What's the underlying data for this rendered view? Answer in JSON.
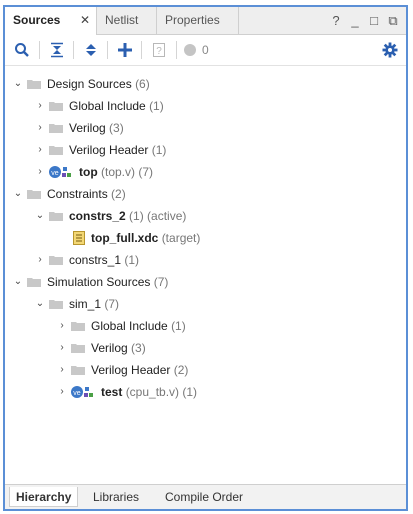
{
  "tabs": [
    {
      "label": "Sources"
    },
    {
      "label": "Netlist"
    },
    {
      "label": "Properties"
    }
  ],
  "tab_close_glyph": "✕",
  "window_controls": {
    "help": "?",
    "minimize": "_",
    "maximize": "□",
    "float": "⧉"
  },
  "toolbar": {
    "ip_count": "0"
  },
  "tree": {
    "design_sources": {
      "label": "Design Sources",
      "count": "(6)"
    },
    "ds_global_include": {
      "label": "Global Include",
      "count": "(1)"
    },
    "ds_verilog": {
      "label": "Verilog",
      "count": "(3)"
    },
    "ds_verilog_header": {
      "label": "Verilog Header",
      "count": "(1)"
    },
    "ds_top": {
      "label": "top",
      "count": "(top.v) (7)"
    },
    "constraints": {
      "label": "Constraints",
      "count": "(2)"
    },
    "constrs_2": {
      "label": "constrs_2",
      "count": "(1) (active)"
    },
    "top_full": {
      "label": "top_full.xdc",
      "count": "(target)"
    },
    "constrs_1": {
      "label": "constrs_1",
      "count": "(1)"
    },
    "simulation_sources": {
      "label": "Simulation Sources",
      "count": "(7)"
    },
    "sim_1": {
      "label": "sim_1",
      "count": "(7)"
    },
    "sim_global_include": {
      "label": "Global Include",
      "count": "(1)"
    },
    "sim_verilog": {
      "label": "Verilog",
      "count": "(3)"
    },
    "sim_verilog_header": {
      "label": "Verilog Header",
      "count": "(2)"
    },
    "sim_test": {
      "label": "test",
      "count": "(cpu_tb.v) (1)"
    }
  },
  "bottom_tabs": [
    {
      "label": "Hierarchy"
    },
    {
      "label": "Libraries"
    },
    {
      "label": "Compile Order"
    }
  ],
  "colors": {
    "accent_border": "#5b8fd6",
    "folder": "#c8c8c8",
    "ve_badge": "#3c78c8",
    "settings_icon": "#2b5fb0"
  },
  "icons": [
    "search-icon",
    "collapse-all-icon",
    "expand-all-icon",
    "add-icon",
    "properties-icon",
    "status-dot-icon",
    "gear-icon",
    "folder-icon",
    "verilog-module-icon",
    "xdc-file-icon",
    "chevron-right-icon",
    "chevron-down-icon"
  ]
}
